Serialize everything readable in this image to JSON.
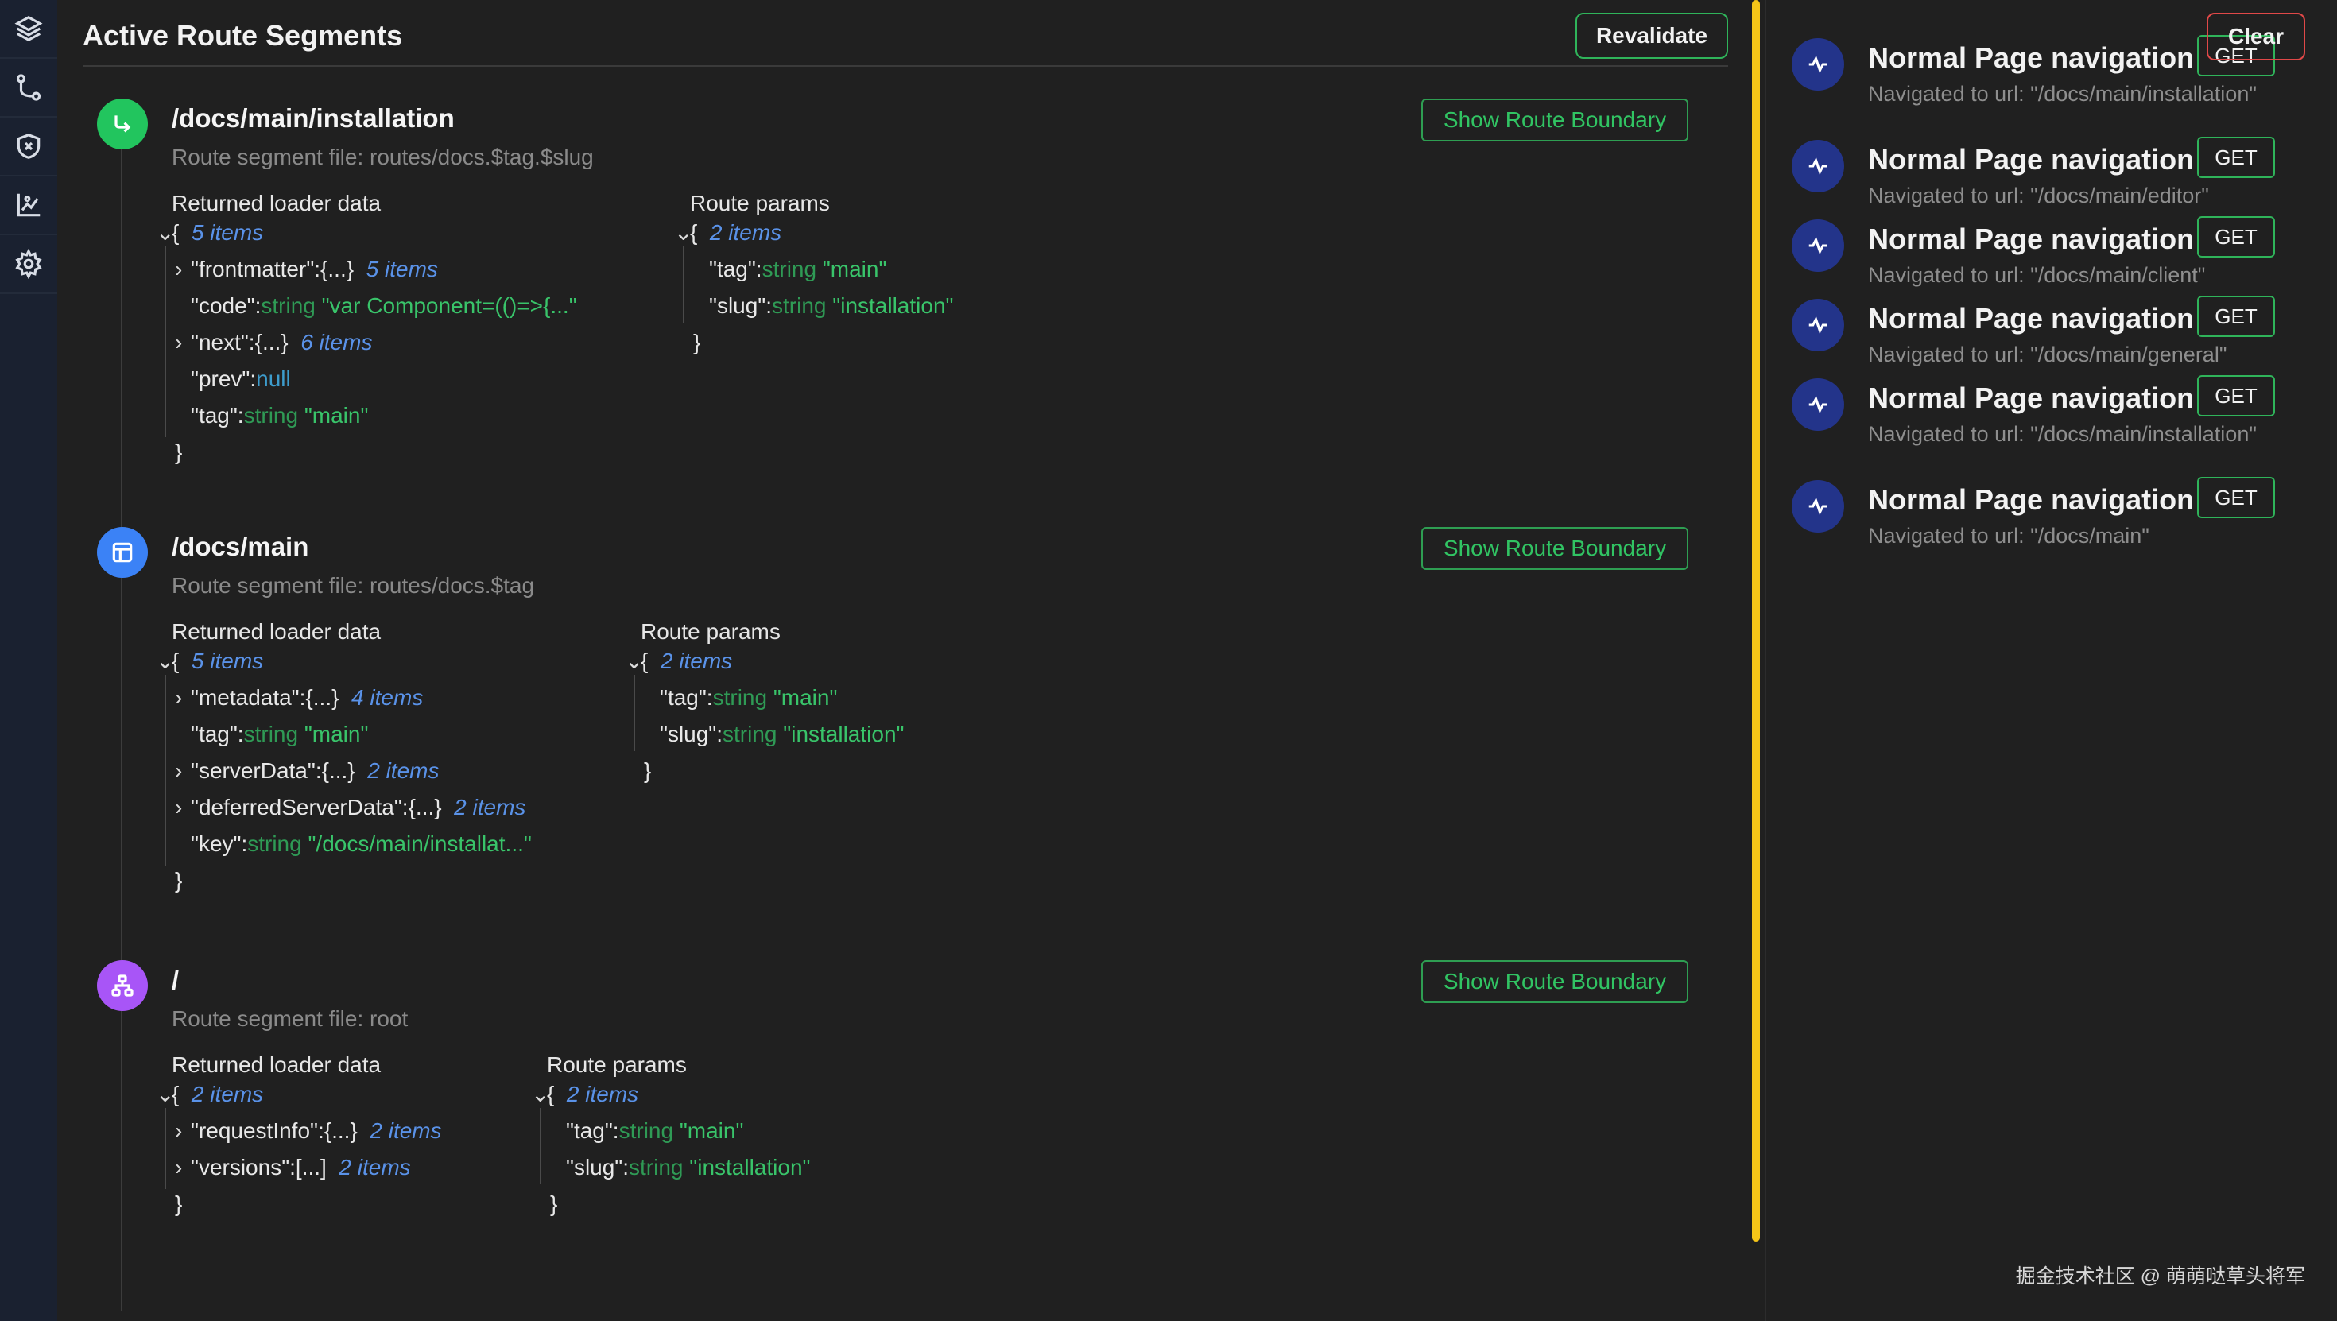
{
  "rail": {
    "items": [
      {
        "icon": "layers-icon"
      },
      {
        "icon": "route-icon"
      },
      {
        "icon": "shield-icon"
      },
      {
        "icon": "chart-icon"
      },
      {
        "icon": "gear-icon"
      }
    ]
  },
  "header": {
    "title": "Active Route Segments",
    "revalidate_label": "Revalidate"
  },
  "segments": [
    {
      "path": "/docs/main/installation",
      "file": "Route segment file: routes/docs.$tag.$slug",
      "boundary_label": "Show Route Boundary",
      "icon": "arrow-turn-icon",
      "icon_color": "#22c55e",
      "loader_label": "Returned loader data",
      "params_label": "Route params",
      "loader": {
        "open": "{",
        "count": "5 items",
        "close": "}",
        "rows": [
          {
            "chev": "›",
            "key": "\"frontmatter\":",
            "type": "",
            "value": "{...}",
            "count": "5 items"
          },
          {
            "chev": "",
            "key": "\"code\":",
            "type": "string",
            "value": "\"var Component=(()=>{...\"",
            "count": ""
          },
          {
            "chev": "›",
            "key": "\"next\":",
            "type": "",
            "value": "{...}",
            "count": "6 items"
          },
          {
            "chev": "",
            "key": "\"prev\":",
            "type": "",
            "value": "null",
            "count": ""
          },
          {
            "chev": "",
            "key": "\"tag\":",
            "type": "string",
            "value": "\"main\"",
            "count": ""
          }
        ]
      },
      "params": {
        "open": "{",
        "count": "2 items",
        "close": "}",
        "rows": [
          {
            "key": "\"tag\":",
            "type": "string",
            "value": "\"main\""
          },
          {
            "key": "\"slug\":",
            "type": "string",
            "value": "\"installation\""
          }
        ]
      }
    },
    {
      "path": "/docs/main",
      "file": "Route segment file: routes/docs.$tag",
      "boundary_label": "Show Route Boundary",
      "icon": "layout-icon",
      "icon_color": "#3b82f6",
      "loader_label": "Returned loader data",
      "params_label": "Route params",
      "loader": {
        "open": "{",
        "count": "5 items",
        "close": "}",
        "rows": [
          {
            "chev": "›",
            "key": "\"metadata\":",
            "type": "",
            "value": "{...}",
            "count": "4 items"
          },
          {
            "chev": "",
            "key": "\"tag\":",
            "type": "string",
            "value": "\"main\"",
            "count": ""
          },
          {
            "chev": "›",
            "key": "\"serverData\":",
            "type": "",
            "value": "{...}",
            "count": "2 items"
          },
          {
            "chev": "›",
            "key": "\"deferredServerData\":",
            "type": "",
            "value": "{...}",
            "count": "2 items"
          },
          {
            "chev": "",
            "key": "\"key\":",
            "type": "string",
            "value": "\"/docs/main/installat...\"",
            "count": ""
          }
        ]
      },
      "params": {
        "open": "{",
        "count": "2 items",
        "close": "}",
        "rows": [
          {
            "key": "\"tag\":",
            "type": "string",
            "value": "\"main\""
          },
          {
            "key": "\"slug\":",
            "type": "string",
            "value": "\"installation\""
          }
        ]
      }
    },
    {
      "path": "/",
      "file": "Route segment file: root",
      "boundary_label": "Show Route Boundary",
      "icon": "sitemap-icon",
      "icon_color": "#a855f7",
      "loader_label": "Returned loader data",
      "params_label": "Route params",
      "loader": {
        "open": "{",
        "count": "2 items",
        "close": "}",
        "rows": [
          {
            "chev": "›",
            "key": "\"requestInfo\":",
            "type": "",
            "value": "{...}",
            "count": "2 items"
          },
          {
            "chev": "›",
            "key": "\"versions\":",
            "type": "",
            "value": "[...]",
            "count": "2 items"
          }
        ]
      },
      "params": {
        "open": "{",
        "count": "2 items",
        "close": "}",
        "rows": [
          {
            "key": "\"tag\":",
            "type": "string",
            "value": "\"main\""
          },
          {
            "key": "\"slug\":",
            "type": "string",
            "value": "\"installation\""
          }
        ]
      }
    }
  ],
  "right_panel": {
    "clear_label": "Clear",
    "nav_items": [
      {
        "title": "Normal Page navigation",
        "method": "GET",
        "desc": "Navigated to url: \"/docs/main/installation\""
      },
      {
        "title": "Normal Page navigation",
        "method": "GET",
        "desc": "Navigated to url: \"/docs/main/editor\""
      },
      {
        "title": "Normal Page navigation",
        "method": "GET",
        "desc": "Navigated to url: \"/docs/main/client\""
      },
      {
        "title": "Normal Page navigation",
        "method": "GET",
        "desc": "Navigated to url: \"/docs/main/general\""
      },
      {
        "title": "Normal Page navigation",
        "method": "GET",
        "desc": "Navigated to url: \"/docs/main/installation\""
      },
      {
        "title": "Normal Page navigation",
        "method": "GET",
        "desc": "Navigated to url: \"/docs/main\""
      }
    ]
  },
  "watermark": "掘金技术社区 @ 萌萌哒草头将军",
  "colors": {
    "accent_green": "#2fb45a",
    "clear_red": "#e04848",
    "scrollbar_yellow": "#f5c518",
    "nav_icon_blue": "#23348a"
  }
}
